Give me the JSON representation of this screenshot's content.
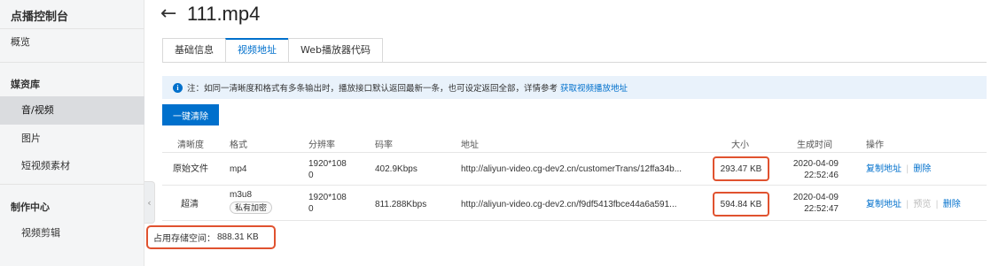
{
  "sidebar": {
    "title": "点播控制台",
    "overview": "概览",
    "media_section": "媒资库",
    "media_items": [
      "音/视频",
      "图片",
      "短视频素材"
    ],
    "production_section": "制作中心",
    "production_items": [
      "视频剪辑"
    ]
  },
  "header": {
    "back_icon": "←",
    "title": "111.mp4"
  },
  "tabs": [
    {
      "label": "基础信息",
      "active": false
    },
    {
      "label": "视频地址",
      "active": true
    },
    {
      "label": "Web播放器代码",
      "active": false
    }
  ],
  "notice": {
    "icon": "info-icon",
    "icon_glyph": "i",
    "text": "注：如同一清晰度和格式有多条输出时，播放接口默认返回最新一条，也可设定返回全部，详情参考",
    "link": "获取视频播放地址"
  },
  "toolbar": {
    "clear_button": "一键清除"
  },
  "table": {
    "headers": [
      "清晰度",
      "格式",
      "分辨率",
      "码率",
      "地址",
      "大小",
      "生成时间",
      "操作"
    ],
    "rows": [
      {
        "definition": "原始文件",
        "format": "mp4",
        "format_tag": "",
        "resolution_line1": "1920*108",
        "resolution_line2": "0",
        "bitrate": "402.9Kbps",
        "url": "http://aliyun-video.cg-dev2.cn/customerTrans/12ffa34b...",
        "size": "293.47 KB",
        "date": "2020-04-09",
        "time": "22:52:46",
        "actions": [
          {
            "label": "复制地址",
            "enabled": true
          },
          {
            "label": "删除",
            "enabled": true
          }
        ]
      },
      {
        "definition": "超清",
        "format": "m3u8",
        "format_tag": "私有加密",
        "resolution_line1": "1920*108",
        "resolution_line2": "0",
        "bitrate": "811.288Kbps",
        "url": "http://aliyun-video.cg-dev2.cn/f9df5413fbce44a6a591...",
        "size": "594.84 KB",
        "date": "2020-04-09",
        "time": "22:52:47",
        "actions": [
          {
            "label": "复制地址",
            "enabled": true
          },
          {
            "label": "预览",
            "enabled": false
          },
          {
            "label": "删除",
            "enabled": true
          }
        ]
      }
    ]
  },
  "storage": {
    "label": "占用存储空间：",
    "value": "888.31 KB"
  },
  "colors": {
    "accent": "#0070cc",
    "highlight_border": "#e0522f",
    "notice_bg": "#e9f2fb",
    "sidebar_bg": "#f4f5f6"
  }
}
